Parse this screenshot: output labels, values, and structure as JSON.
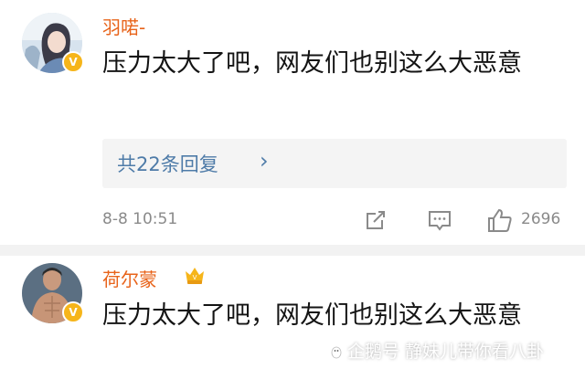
{
  "comments": [
    {
      "username": "羽喏-",
      "avatar_icon": "girl-photo-avatar",
      "verified_badge": "V",
      "text": "压力太大了吧，网友们也别这么大恶意",
      "replies_label": "共22条回复",
      "replies_arrow": "›",
      "timestamp": "8-8 10:51",
      "likes": "2696"
    },
    {
      "username": "荷尔蒙",
      "avatar_icon": "man-photo-avatar",
      "vip_icon": "vip-crown-icon",
      "verified_badge": "V",
      "text": "压力太大了吧，网友们也别这么大恶意"
    }
  ],
  "watermark": "企鹅号 静妹儿带你看八卦",
  "colors": {
    "username": "#e8641b",
    "link": "#4e7ba8",
    "meta": "#8a8a8a",
    "badge": "#f6b51a"
  }
}
